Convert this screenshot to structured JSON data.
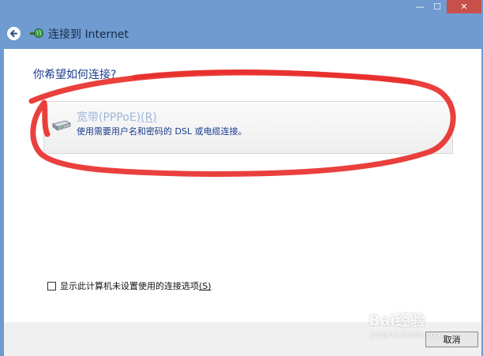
{
  "window": {
    "minimize_glyph": "—",
    "maximize_glyph": "☐",
    "close_glyph": "✕"
  },
  "header": {
    "title": "连接到 Internet",
    "back_icon": "back-arrow-icon",
    "app_icon": "network-globe-icon"
  },
  "main": {
    "question": "你希望如何连接?",
    "options": [
      {
        "title": "宽带(PPPoE)",
        "access_key": "(R)",
        "description": "使用需要用户名和密码的 DSL 或电缆连接。",
        "icon": "modem-icon"
      }
    ],
    "checkbox": {
      "label": "显示此计算机未设置使用的连接选项",
      "access_key": "(S)",
      "checked": false
    }
  },
  "footer": {
    "cancel_label": "取消"
  },
  "annotation": {
    "color": "#e8302c"
  },
  "watermark": {
    "brand": "Bai经验",
    "site": "jingyan.baidu.com"
  },
  "colors": {
    "window_frame": "#6f9bd0",
    "close_button": "#c7504a",
    "link_blue": "#1a3c8c"
  }
}
